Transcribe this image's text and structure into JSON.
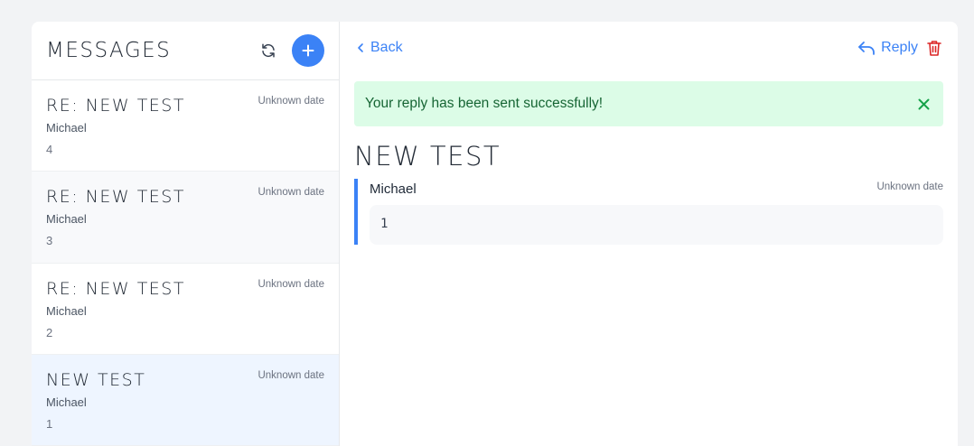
{
  "colors": {
    "accent": "#3b82f6",
    "danger": "#dc2626",
    "success_bg": "#dcfce7",
    "success_text": "#166534"
  },
  "sidebar": {
    "title": "MESSAGES",
    "refresh_icon": "refresh-icon",
    "add_icon": "plus-icon",
    "items": [
      {
        "subject": "RE: NEW TEST",
        "date": "Unknown date",
        "sender": "Michael",
        "count": "4"
      },
      {
        "subject": "RE: NEW TEST",
        "date": "Unknown date",
        "sender": "Michael",
        "count": "3"
      },
      {
        "subject": "RE: NEW TEST",
        "date": "Unknown date",
        "sender": "Michael",
        "count": "2"
      },
      {
        "subject": "NEW TEST",
        "date": "Unknown date",
        "sender": "Michael",
        "count": "1"
      }
    ]
  },
  "toolbar": {
    "back_label": "Back",
    "reply_label": "Reply",
    "delete_icon": "trash-icon"
  },
  "alert": {
    "text": "Your reply has been sent successfully!"
  },
  "message": {
    "subject": "NEW TEST",
    "sender": "Michael",
    "date": "Unknown date",
    "body": "1"
  }
}
